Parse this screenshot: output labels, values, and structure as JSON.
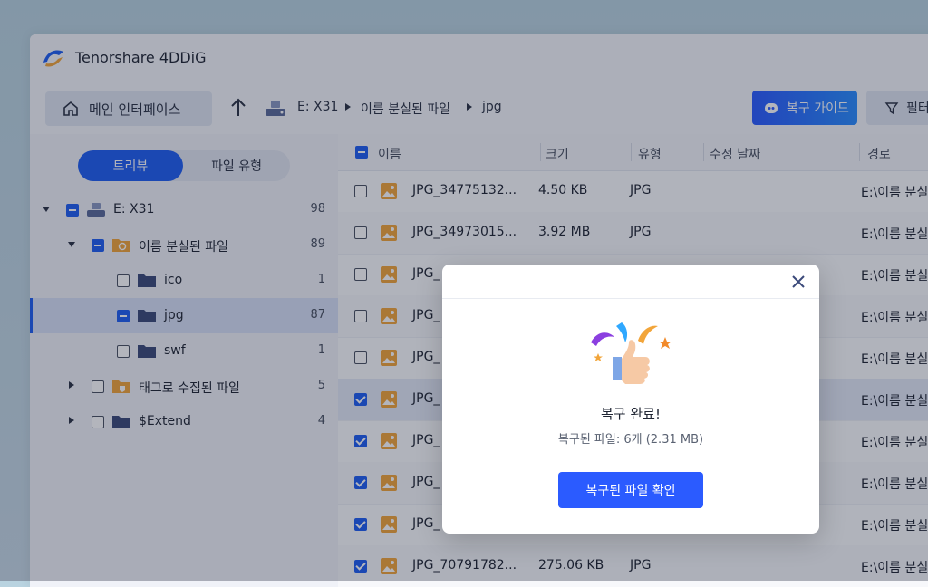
{
  "app": {
    "title": "Tenorshare 4DDiG"
  },
  "toolbar": {
    "home_label": "메인 인터페이스",
    "breadcrumb": [
      "E: X31",
      "이름 분실된 파일",
      "jpg"
    ],
    "guide_label": "복구 가이드",
    "filter_label": "필터"
  },
  "sidebar": {
    "view_tabs": {
      "tree": "트리뷰",
      "type": "파일 유형"
    },
    "tree": [
      {
        "label": "E: X31",
        "count": "98"
      },
      {
        "label": "이름 분실된 파일",
        "count": "89"
      },
      {
        "label": "ico",
        "count": "1"
      },
      {
        "label": "jpg",
        "count": "87"
      },
      {
        "label": "swf",
        "count": "1"
      },
      {
        "label": "태그로 수집된 파일",
        "count": "5"
      },
      {
        "label": "$Extend",
        "count": "4"
      }
    ]
  },
  "table": {
    "headers": {
      "name": "이름",
      "size": "크기",
      "type": "유형",
      "date": "수정 날짜",
      "path": "경로"
    },
    "rows": [
      {
        "name": "JPG_34775132...",
        "size": "4.50 KB",
        "type": "JPG",
        "path": "E:\\이름 분실"
      },
      {
        "name": "JPG_34973015...",
        "size": "3.92 MB",
        "type": "JPG",
        "path": "E:\\이름 분실"
      },
      {
        "name": "JPG_",
        "size": "",
        "type": "",
        "path": "E:\\이름 분실"
      },
      {
        "name": "JPG_",
        "size": "",
        "type": "",
        "path": "E:\\이름 분실"
      },
      {
        "name": "JPG_",
        "size": "",
        "type": "",
        "path": "E:\\이름 분실"
      },
      {
        "name": "JPG_",
        "size": "",
        "type": "",
        "path": "E:\\이름 분실"
      },
      {
        "name": "JPG_",
        "size": "",
        "type": "",
        "path": "E:\\이름 분실"
      },
      {
        "name": "JPG_",
        "size": "",
        "type": "",
        "path": "E:\\이름 분실"
      },
      {
        "name": "JPG_",
        "size": "",
        "type": "",
        "path": "E:\\이름 분실"
      },
      {
        "name": "JPG_70791782...",
        "size": "275.06 KB",
        "type": "JPG",
        "path": "E:\\이름 분실"
      }
    ]
  },
  "modal": {
    "title": "복구 완료!",
    "subtitle": "복구된 파일: 6개 (2.31 MB)",
    "button_label": "복구된 파일 확인"
  },
  "colors": {
    "accent": "#1f5ff2",
    "button": "#2b5bff",
    "folder": "#3b4a7a",
    "image_icon": "#f2a53a"
  }
}
